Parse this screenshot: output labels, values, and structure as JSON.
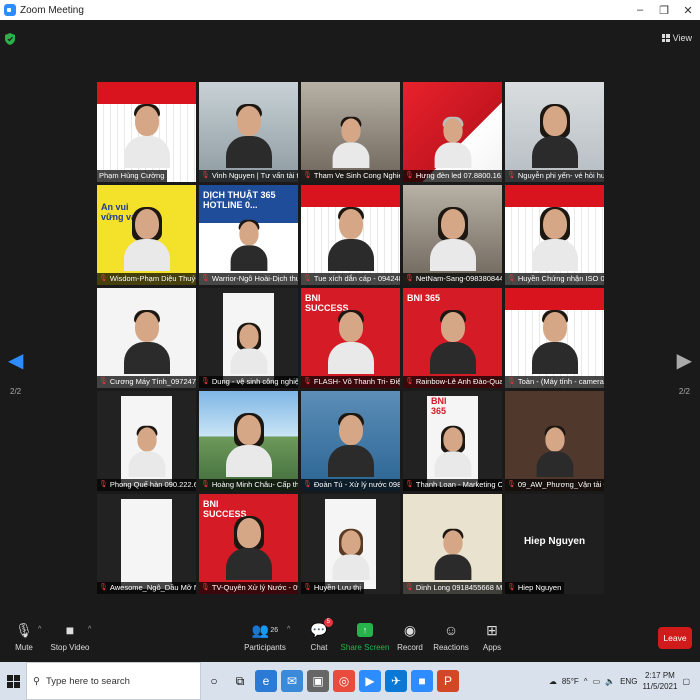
{
  "window": {
    "title": "Zoom Meeting",
    "controls": [
      "–",
      "❐",
      "✕"
    ]
  },
  "meeting": {
    "view_label": "View",
    "page_left": "2/2",
    "page_right": "2/2",
    "tiles": [
      {
        "name": "Phạm Hùng Cường",
        "muted": false,
        "active": true
      },
      {
        "name": "Vinh Nguyen | Tư vấn tài tr...",
        "muted": true
      },
      {
        "name": "Tham Ve Sinh Cong Nghiep",
        "muted": true
      },
      {
        "name": "Hưng đèn led 07.8800.1616",
        "muted": true
      },
      {
        "name": "Nguyễn phi yến- vé hỏi hư...",
        "muted": true
      },
      {
        "name": "Wisdom-Phạm Diệu Thuý-...",
        "muted": true,
        "overlay": "An vui\nvững vai"
      },
      {
        "name": "Warrior-Ngô Hoài-Dịch thu...",
        "muted": true,
        "overlay": "DỊCH THUẬT 365\nHOTLINE 0..."
      },
      {
        "name": "Tue xích dắn cáp - 094248...",
        "muted": true
      },
      {
        "name": "NetNam-Sang-0983808448",
        "muted": true
      },
      {
        "name": "Huyền Chứng nhận ISO 09...",
        "muted": true
      },
      {
        "name": "Cương Máy Tính_0972479...",
        "muted": true
      },
      {
        "name": "Dung - vệ sinh công nghiệp",
        "muted": true
      },
      {
        "name": "FLASH- Võ Thanh Tri- Điện...",
        "muted": true,
        "overlay": "BNI\nSUCCESS"
      },
      {
        "name": "Rainbow-Lê Anh Đào-Quat...",
        "muted": true,
        "overlay": "BNI 365"
      },
      {
        "name": "Toàn - (Máy tính - camera...",
        "muted": true
      },
      {
        "name": "Phong Quế hàn 090.222.61...",
        "muted": true
      },
      {
        "name": "Hoàng Minh Châu- Cấp th...",
        "muted": true
      },
      {
        "name": "Đoàn Tú - Xử lý nước 0988...",
        "muted": true
      },
      {
        "name": "Thanh Loan - Marketing O...",
        "muted": true,
        "overlay": "BNI\n365"
      },
      {
        "name": "09_AW_Phương_Vận tải Qu...",
        "muted": true
      },
      {
        "name": "Awesome_Ngô_Dầu Mỡ N...",
        "muted": true
      },
      {
        "name": "TV-Quyên Xử lý Nước - 09...",
        "muted": true,
        "overlay": "BNI\nSUCCESS"
      },
      {
        "name": "Huyền Lưu thị",
        "muted": true
      },
      {
        "name": "Dinh Long 0918455668 ME...",
        "muted": true
      },
      {
        "name": "Hiep Nguyen",
        "muted": true,
        "big_name": "Hiep Nguyen"
      }
    ]
  },
  "toolbar": {
    "mute": "Mute",
    "stop_video": "Stop Video",
    "participants": "Participants",
    "participants_count": "26",
    "chat": "Chat",
    "chat_badge": "5",
    "share_screen": "Share Screen",
    "record": "Record",
    "reactions": "Reactions",
    "apps": "Apps",
    "leave": "Leave"
  },
  "taskbar": {
    "search_placeholder": "Type here to search",
    "weather": "85°F",
    "lang": "ENG",
    "time": "2:17 PM",
    "date": "11/5/2021"
  },
  "colors": {
    "accent": "#2d8cff",
    "share": "#28b24b",
    "leave": "#d11b1b",
    "active_border": "#f3d61a"
  }
}
